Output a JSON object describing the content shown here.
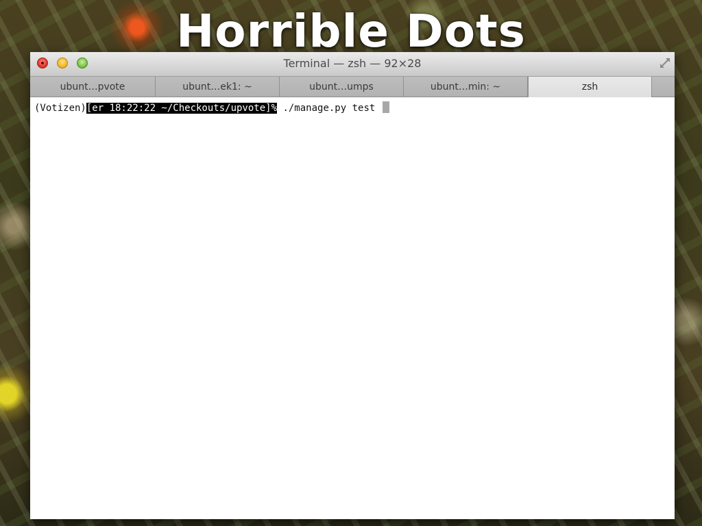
{
  "slide": {
    "title": "Horrible Dots"
  },
  "window": {
    "title": "Terminal — zsh — 92×28",
    "controls": {
      "close_icon": "close-icon",
      "minimize_icon": "minimize-icon",
      "zoom_icon": "zoom-icon",
      "fullscreen_icon": "fullscreen-icon"
    }
  },
  "tabs": [
    {
      "label": "ubunt…pvote",
      "active": false
    },
    {
      "label": "ubunt…ek1: ~",
      "active": false
    },
    {
      "label": "ubunt…umps",
      "active": false
    },
    {
      "label": "ubunt…min: ~",
      "active": false
    },
    {
      "label": "zsh",
      "active": true
    }
  ],
  "terminal": {
    "lines": [
      {
        "prefix": "(Votizen)",
        "prompt": "[er 18:22:22 ~/Checkouts/upvote]%",
        "command": " ./manage.py test "
      }
    ]
  },
  "colors": {
    "prompt_highlight_bg": "#000000",
    "prompt_highlight_fg": "#ffffff",
    "cursor": "#a8a8a8",
    "terminal_bg": "#ffffff"
  }
}
